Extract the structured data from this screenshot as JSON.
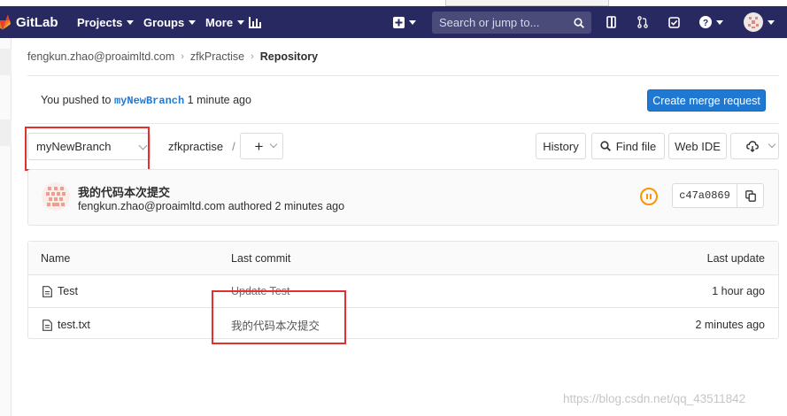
{
  "nav": {
    "brand": "GitLab",
    "menus": [
      "Projects",
      "Groups",
      "More"
    ],
    "search_placeholder": "Search or jump to..."
  },
  "breadcrumb": {
    "items": [
      "fengkun.zhao@proaimltd.com",
      "zfkPractise",
      "Repository"
    ]
  },
  "push_notice": {
    "prefix": "You pushed to",
    "branch": "myNewBranch",
    "suffix": "1 minute ago",
    "button": "Create merge request"
  },
  "toolbar": {
    "branch": "myNewBranch",
    "path": "zfkpractise",
    "path_sep": "/",
    "add": "+",
    "history": "History",
    "find_file": "Find file",
    "web_ide": "Web IDE"
  },
  "last_commit": {
    "title": "我的代码本次提交",
    "author": "fengkun.zhao@proaimltd.com",
    "authored": "authored 2 minutes ago",
    "sha": "c47a0869"
  },
  "files": {
    "headers": [
      "Name",
      "Last commit",
      "Last update"
    ],
    "rows": [
      {
        "name": "Test",
        "commit": "Update Test",
        "updated": "1 hour ago"
      },
      {
        "name": "test.txt",
        "commit": "我的代码本次提交",
        "updated": "2 minutes ago"
      }
    ]
  },
  "watermark": "https://blog.csdn.net/qq_43511842",
  "colors": {
    "navbar": "#292961",
    "primary": "#1f78d1",
    "highlight": "#e0312f",
    "pipeline_pending": "#fc9403"
  }
}
